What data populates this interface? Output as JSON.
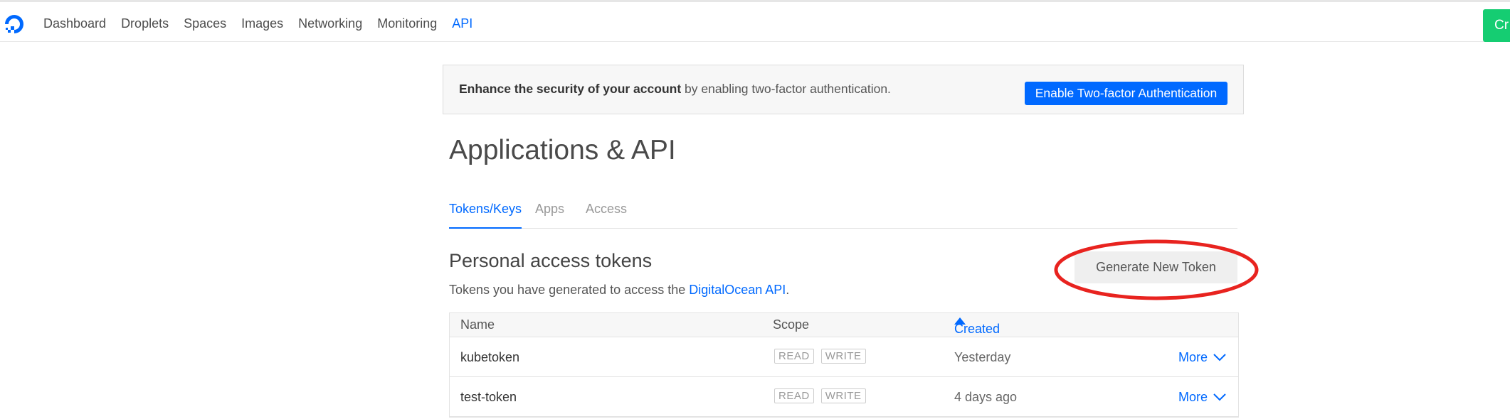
{
  "nav": {
    "items": [
      "Dashboard",
      "Droplets",
      "Spaces",
      "Images",
      "Networking",
      "Monitoring",
      "API"
    ],
    "active": "API",
    "create_label": "Cr"
  },
  "banner": {
    "text_bold": "Enhance the security of your account",
    "text_rest": " by enabling two-factor authentication.",
    "button_label": "Enable Two-factor Authentication"
  },
  "page": {
    "title": "Applications & API"
  },
  "tabs": [
    "Tokens/Keys",
    "Apps",
    "Access"
  ],
  "active_tab": "Tokens/Keys",
  "tokens": {
    "title": "Personal access tokens",
    "subtitle_prefix": "Tokens you have generated to access the ",
    "subtitle_link": "DigitalOcean API",
    "subtitle_suffix": ".",
    "generate_label": "Generate New Token",
    "columns": {
      "name": "Name",
      "scope": "Scope",
      "created": "Created"
    },
    "rows": [
      {
        "name": "kubetoken",
        "scopes": [
          "READ",
          "WRITE"
        ],
        "created": "Yesterday",
        "more": "More"
      },
      {
        "name": "test-token",
        "scopes": [
          "READ",
          "WRITE"
        ],
        "created": "4 days ago",
        "more": "More"
      }
    ]
  },
  "colors": {
    "accent": "#0069ff",
    "create_green": "#15cd72",
    "highlight_red": "#e8231f"
  }
}
